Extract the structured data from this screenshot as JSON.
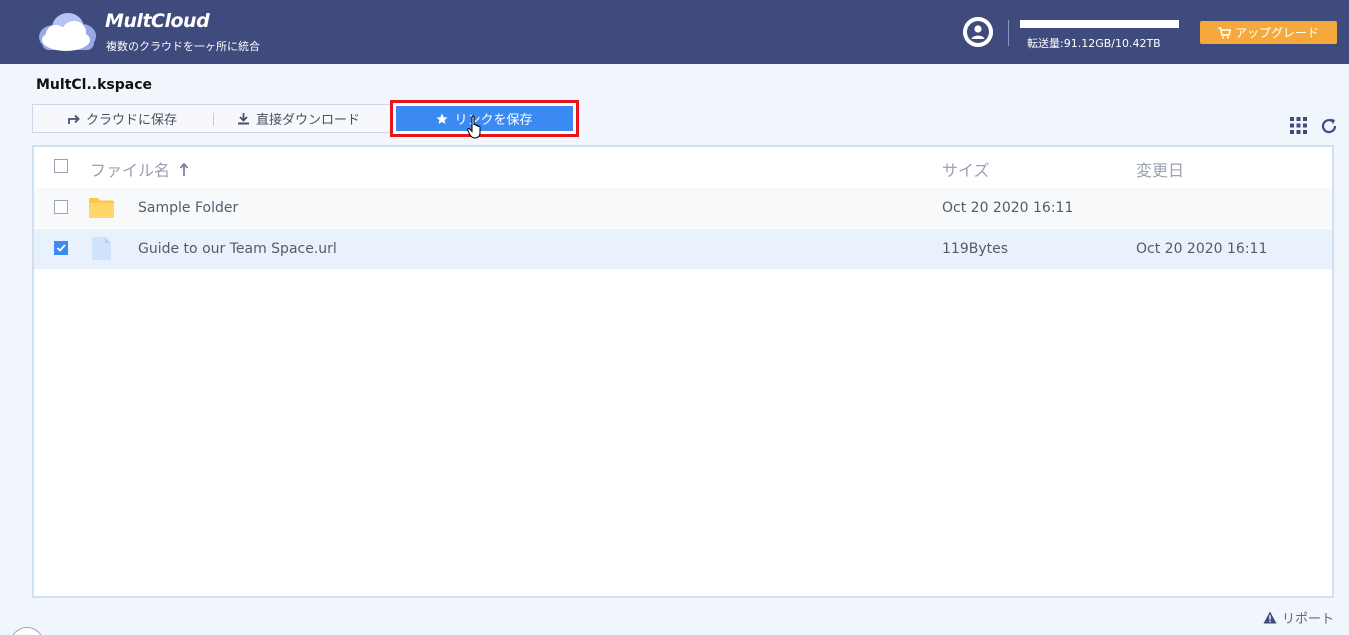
{
  "header": {
    "brand": "MultCloud",
    "tagline": "複数のクラウドを一ヶ所に統合",
    "usage": "転送量:91.12GB/10.42TB",
    "upgrade_label": "アップグレード"
  },
  "breadcrumb": "MultCl..kspace",
  "toolbar": {
    "save_to_cloud": "クラウドに保存",
    "direct_download": "直接ダウンロード",
    "save_link": "リンクを保存"
  },
  "table": {
    "columns": {
      "name": "ファイル名",
      "size": "サイズ",
      "modified": "変更日"
    },
    "rows": [
      {
        "name": "Sample Folder",
        "type": "folder",
        "size": "Oct 20 2020 16:11",
        "modified": "",
        "checked": false
      },
      {
        "name": "Guide to our Team Space.url",
        "type": "file",
        "size": "119Bytes",
        "modified": "Oct 20 2020 16:11",
        "checked": true
      }
    ]
  },
  "footer": {
    "report": "リポート"
  },
  "colors": {
    "header_bg": "#3f4a7d",
    "accent_blue": "#3b8af3",
    "upgrade": "#f5a93d",
    "highlight_border": "#e8141b"
  }
}
